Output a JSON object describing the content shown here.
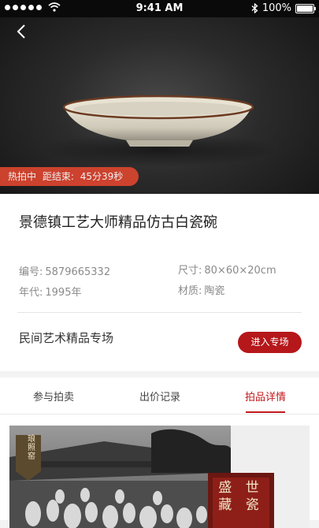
{
  "status_bar": {
    "time": "9:41 AM",
    "battery": "100%"
  },
  "auction": {
    "status_label": "热拍中",
    "countdown_prefix": "距结束:",
    "countdown_value": "45分39秒"
  },
  "item": {
    "title": "景德镇工艺大师精品仿古白瓷碗",
    "number_label": "编号:",
    "number_value": "5879665332",
    "size_label": "尺寸:",
    "size_value": "80×60×20cm",
    "year_label": "年代:",
    "year_value": "1995年",
    "material_label": "材质:",
    "material_value": "陶瓷"
  },
  "topic": {
    "name": "民间艺术精品专场",
    "enter_label": "进入专场"
  },
  "tabs": [
    {
      "label": "参与拍卖"
    },
    {
      "label": "出价记录"
    },
    {
      "label": "拍品详情"
    }
  ],
  "detail_image": {
    "seal_text": "琅 照 窑",
    "stamp_text": "盛 世 藏 瓷"
  },
  "colors": {
    "accent": "#c0191c",
    "countdown_bg": "#d9452f"
  }
}
